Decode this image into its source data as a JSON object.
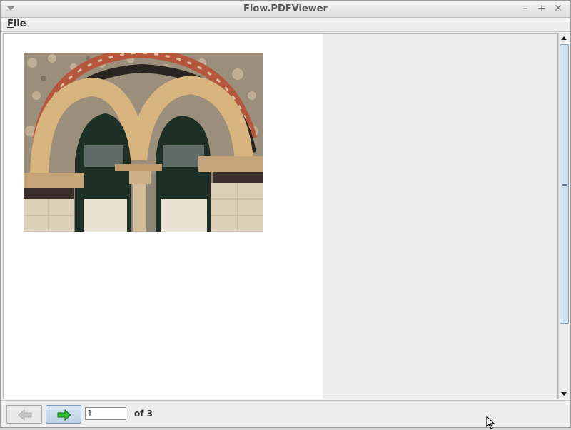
{
  "window": {
    "title": "Flow.PDFViewer"
  },
  "menubar": {
    "file_label": "File"
  },
  "viewer": {
    "image_alt": "Photo of two stone arched windows with a central column"
  },
  "navigation": {
    "prev_icon": "arrow-left-icon",
    "next_icon": "arrow-right-icon",
    "page_value": "1",
    "of_label": "of 3"
  },
  "colors": {
    "next_arrow": "#2fbf2f",
    "prev_arrow": "#bdbdbd"
  }
}
